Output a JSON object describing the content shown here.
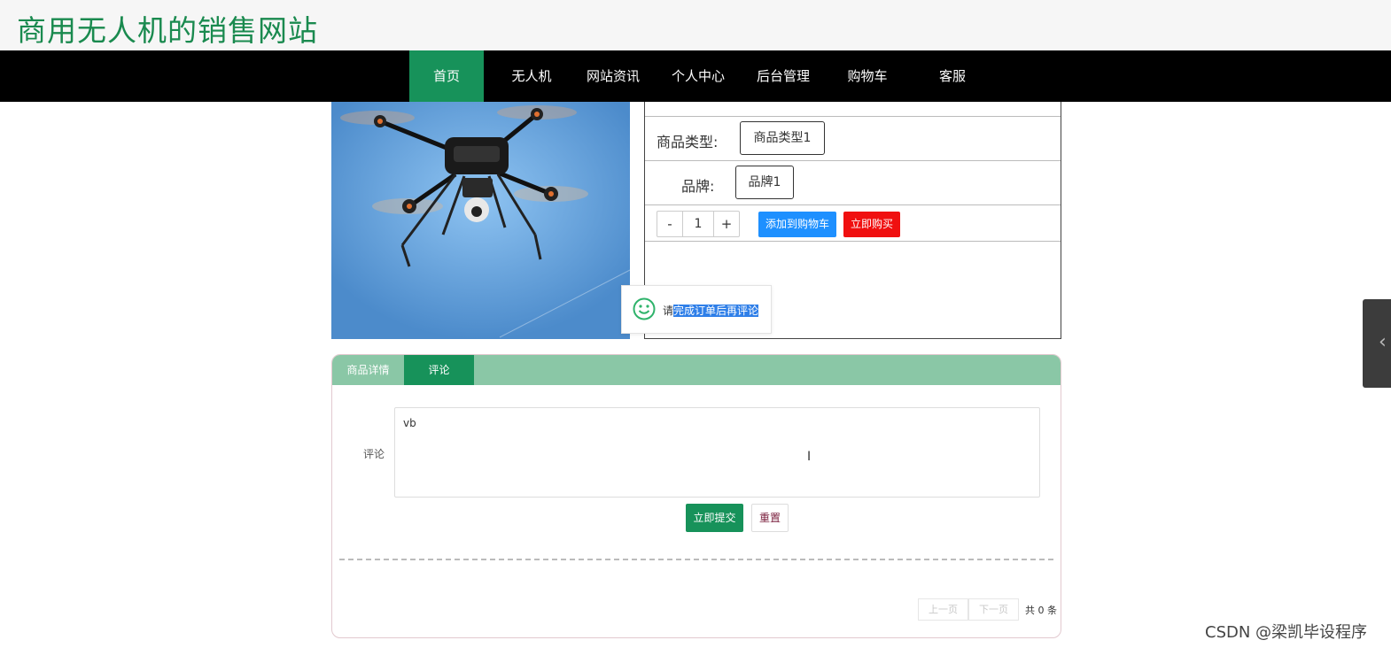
{
  "site": {
    "title": "商用无人机的销售网站"
  },
  "nav": {
    "items": [
      {
        "label": "首页",
        "active": true
      },
      {
        "label": "无人机",
        "active": false
      },
      {
        "label": "网站资讯",
        "active": false
      },
      {
        "label": "个人中心",
        "active": false
      },
      {
        "label": "后台管理",
        "active": false
      },
      {
        "label": "购物车",
        "active": false
      },
      {
        "label": "客服",
        "active": false
      }
    ]
  },
  "product": {
    "type_label": "商品类型:",
    "type_value": "商品类型1",
    "brand_label": "品牌:",
    "brand_value": "品牌1",
    "quantity": "1",
    "minus": "-",
    "plus": "+",
    "add_to_cart": "添加到购物车",
    "buy_now": "立即购买"
  },
  "toast": {
    "prefix": "请",
    "selected": "完成订单后再评论",
    "icon": "smile-icon"
  },
  "tabs": [
    {
      "label": "商品详情",
      "active": false
    },
    {
      "label": "评论",
      "active": true
    }
  ],
  "comment": {
    "label": "评论",
    "value": "vb",
    "submit": "立即提交",
    "reset": "重置"
  },
  "pagination": {
    "prev": "上一页",
    "next": "下一页",
    "total": "共 0 条"
  },
  "watermark": "CSDN @梁凯毕设程序",
  "colors": {
    "brand_green": "#17925a",
    "tab_bar": "#8ac7a6",
    "cart_blue": "#1e90ff",
    "buy_red": "#f01010"
  }
}
